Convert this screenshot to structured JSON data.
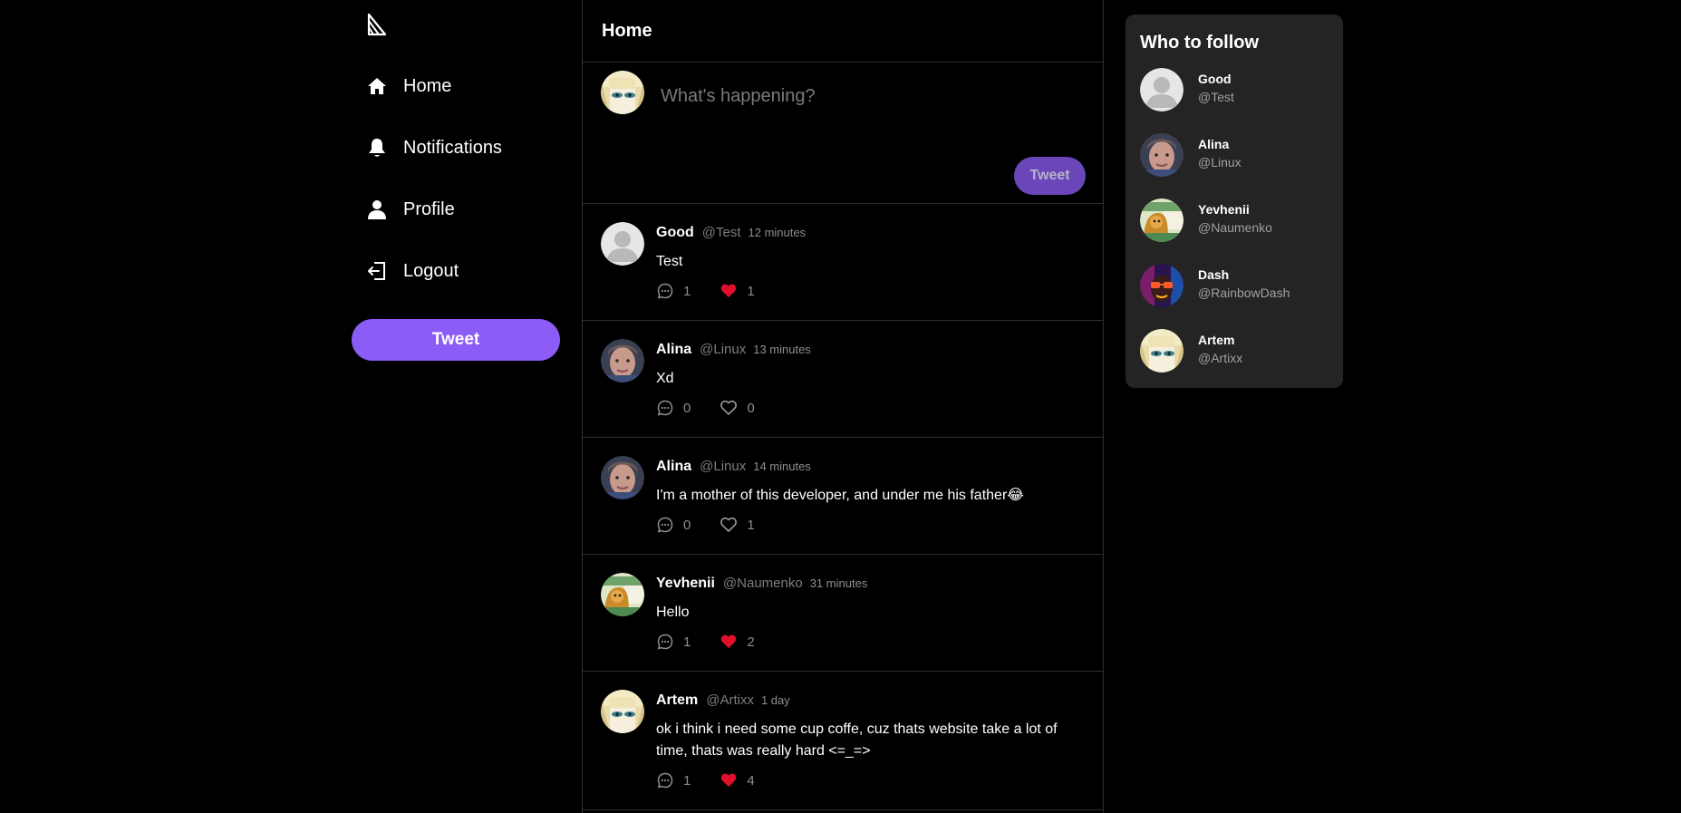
{
  "sidebar": {
    "logo": "app-logo",
    "items": [
      {
        "label": "Home",
        "icon": "home-icon"
      },
      {
        "label": "Notifications",
        "icon": "bell-icon"
      },
      {
        "label": "Profile",
        "icon": "user-icon"
      },
      {
        "label": "Logout",
        "icon": "logout-icon"
      }
    ],
    "tweet_label": "Tweet"
  },
  "feed": {
    "title": "Home",
    "composer": {
      "placeholder": "What's happening?",
      "tweet_label": "Tweet"
    },
    "posts": [
      {
        "name": "Good",
        "handle": "@Test",
        "time": "12 minutes",
        "text": "Test",
        "comments": "1",
        "likes": "1",
        "liked": true
      },
      {
        "name": "Alina",
        "handle": "@Linux",
        "time": "13 minutes",
        "text": "Xd",
        "comments": "0",
        "likes": "0",
        "liked": false
      },
      {
        "name": "Alina",
        "handle": "@Linux",
        "time": "14 minutes",
        "text": "I'm a mother of this developer, and under me his father😂",
        "comments": "0",
        "likes": "1",
        "liked": false
      },
      {
        "name": "Yevhenii",
        "handle": "@Naumenko",
        "time": "31 minutes",
        "text": "Hello",
        "comments": "1",
        "likes": "2",
        "liked": true
      },
      {
        "name": "Artem",
        "handle": "@Artixx",
        "time": "1 day",
        "text": "ok i think i need some cup coffe, cuz thats website take a lot of time, thats was really hard <=_=>",
        "comments": "1",
        "likes": "4",
        "liked": true
      }
    ]
  },
  "who_to_follow": {
    "title": "Who to follow",
    "users": [
      {
        "name": "Good",
        "handle": "@Test"
      },
      {
        "name": "Alina",
        "handle": "@Linux"
      },
      {
        "name": "Yevhenii",
        "handle": "@Naumenko"
      },
      {
        "name": "Dash",
        "handle": "@RainbowDash"
      },
      {
        "name": "Artem",
        "handle": "@Artixx"
      }
    ]
  },
  "colors": {
    "accent": "#8b5cf6",
    "accent_dim": "#6a46b8",
    "like_active": "#e0102a",
    "background": "#000000",
    "panel": "#242424"
  }
}
